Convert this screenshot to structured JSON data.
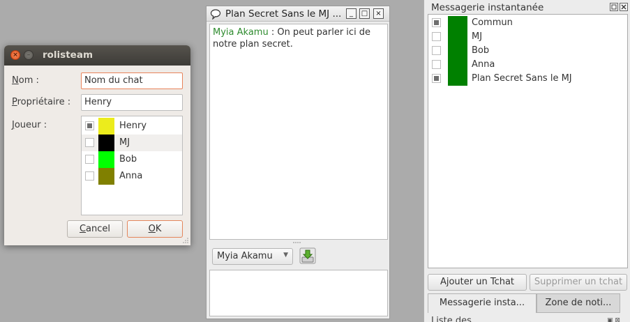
{
  "chat_window": {
    "title": "Plan Secret Sans le MJ ...",
    "buttons": {
      "minimize": "_",
      "maximize": "□",
      "close": "×"
    },
    "messages": [
      {
        "author": "Myia Akamu",
        "text": " : On peut parler ici de notre plan secret."
      }
    ],
    "sender_select": {
      "value": "Myia Akamu",
      "options": [
        "Myia Akamu"
      ]
    },
    "input_value": ""
  },
  "dock": {
    "title": "Messagerie instantanée",
    "rooms": [
      {
        "label": "Commun",
        "checked": "partial",
        "color": "#008000"
      },
      {
        "label": "MJ",
        "checked": "none",
        "color": "#008000"
      },
      {
        "label": "Bob",
        "checked": "none",
        "color": "#008000"
      },
      {
        "label": "Anna",
        "checked": "none",
        "color": "#008000"
      },
      {
        "label": "Plan Secret Sans le MJ",
        "checked": "partial",
        "color": "#008000"
      }
    ],
    "add_button": "Ajouter un Tchat",
    "delete_button": "Supprimer un tchat",
    "tabs": [
      "Messagerie insta...",
      "Zone de noti..."
    ],
    "bottom_text": "Liste des..."
  },
  "dialog": {
    "title": "rolisteam",
    "name_label_key": "N",
    "name_label_rest": "om :",
    "name_value": "Nom du chat",
    "owner_label_key": "P",
    "owner_label_rest": "ropriétaire :",
    "owner_value": "Henry",
    "player_label_key": "J",
    "player_label_rest": "oueur :",
    "players": [
      {
        "label": "Henry",
        "checked": "partial",
        "color": "#ecec1c"
      },
      {
        "label": "MJ",
        "checked": "none",
        "color": "#000000"
      },
      {
        "label": "Bob",
        "checked": "none",
        "color": "#00ff00"
      },
      {
        "label": "Anna",
        "checked": "none",
        "color": "#808000"
      }
    ],
    "cancel_key": "C",
    "cancel_rest": "ancel",
    "ok_key": "O",
    "ok_rest": "K"
  }
}
